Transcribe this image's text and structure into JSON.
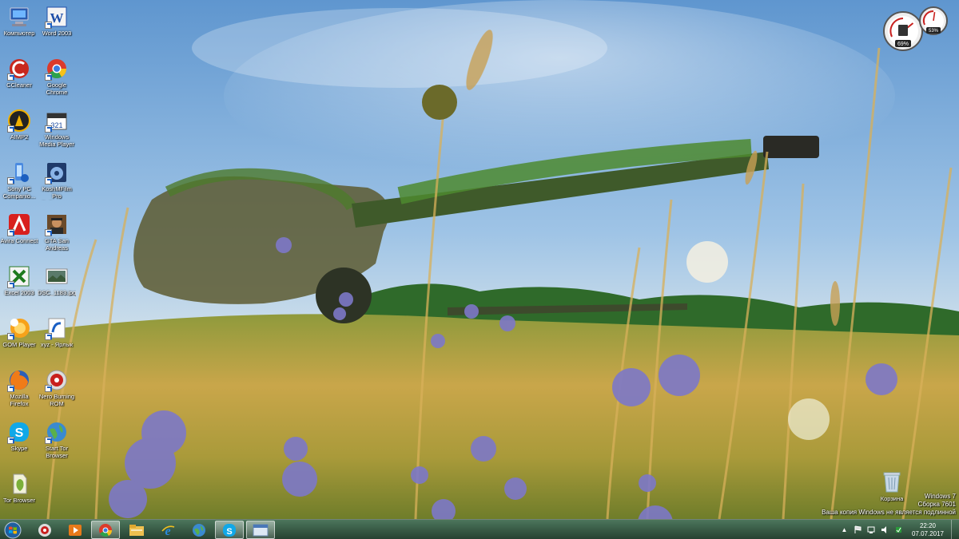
{
  "desktop": {
    "column1": [
      {
        "label": "Компьютер",
        "icon": "computer-icon"
      },
      {
        "label": "CCleaner",
        "icon": "ccleaner-icon"
      },
      {
        "label": "AIMP2",
        "icon": "aimp-icon"
      },
      {
        "label": "Sony PC Companio...",
        "icon": "sony-pc-companion-icon"
      },
      {
        "label": "Avira Connect",
        "icon": "avira-icon"
      },
      {
        "label": "Excel 2003",
        "icon": "excel-icon"
      },
      {
        "label": "GOM Player",
        "icon": "gom-player-icon"
      },
      {
        "label": "Mozilla Firefox",
        "icon": "firefox-icon"
      },
      {
        "label": "Skype",
        "icon": "skype-icon"
      },
      {
        "label": "Tor Browser",
        "icon": "tor-browser-icon"
      }
    ],
    "column2": [
      {
        "label": "Word 2003",
        "icon": "word-icon"
      },
      {
        "label": "Google Chrome",
        "icon": "chrome-icon"
      },
      {
        "label": "Windows Media Player",
        "icon": "media-player-icon"
      },
      {
        "label": "KoshMFilm Pro Рейдкодер",
        "icon": "film-app-icon"
      },
      {
        "label": "GTA San Andreas",
        "icon": "gta-icon"
      },
      {
        "label": "DSC_1183.jpg",
        "icon": "photo-file-icon"
      },
      {
        "label": "xyz - Ярлык",
        "icon": "shortcut-icon"
      },
      {
        "label": "Nero Burning ROM",
        "icon": "nero-icon"
      },
      {
        "label": "Start Tor Browser",
        "icon": "tor-globe-icon"
      }
    ],
    "recycle_bin": {
      "label": "Корзина"
    }
  },
  "gadget": {
    "cpu_percent": "69%",
    "memory_percent": "53%",
    "cpu_value": 0.69,
    "memory_value": 0.53
  },
  "watermark": {
    "line1": "Windows 7",
    "line2": "Сборка 7601",
    "line3": "Ваша копия Windows не является подлинной"
  },
  "taskbar": {
    "pinned": [
      "nero-icon",
      "media-player-icon",
      "chrome-icon",
      "explorer-icon",
      "ie-icon",
      "tor-globe-icon",
      "skype-icon",
      "window-icon"
    ],
    "active_index": 2,
    "clock": {
      "time": "22:20",
      "date": "07.07.2017"
    }
  }
}
